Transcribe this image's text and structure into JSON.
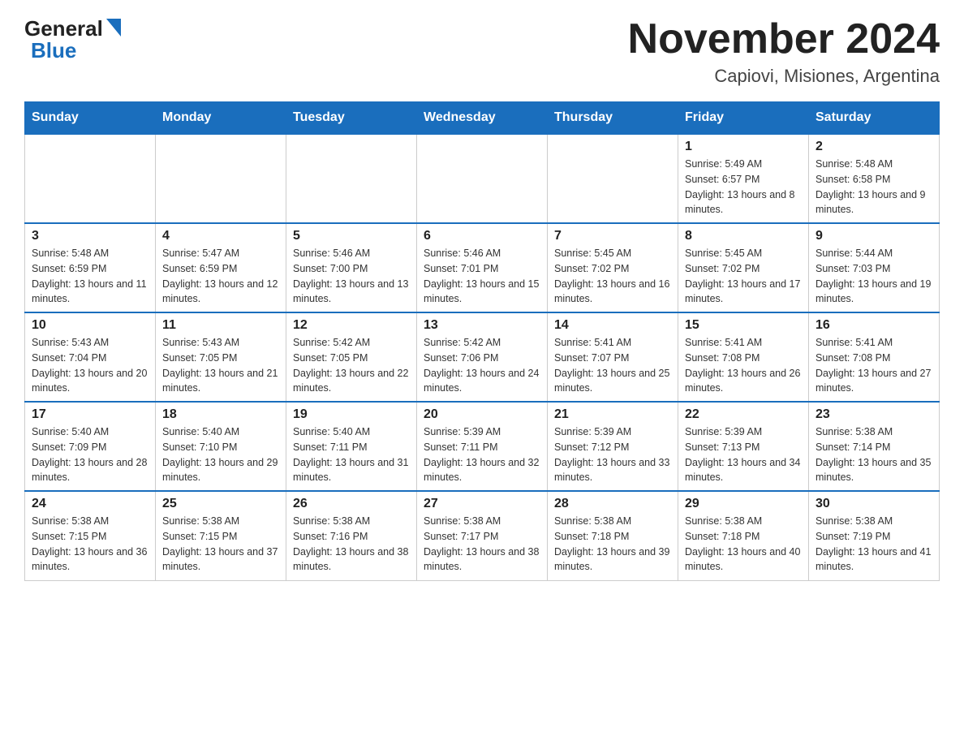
{
  "header": {
    "logo_general": "General",
    "logo_blue": "Blue",
    "title": "November 2024",
    "subtitle": "Capiovi, Misiones, Argentina"
  },
  "weekdays": [
    "Sunday",
    "Monday",
    "Tuesday",
    "Wednesday",
    "Thursday",
    "Friday",
    "Saturday"
  ],
  "weeks": [
    [
      {
        "day": "",
        "info": ""
      },
      {
        "day": "",
        "info": ""
      },
      {
        "day": "",
        "info": ""
      },
      {
        "day": "",
        "info": ""
      },
      {
        "day": "",
        "info": ""
      },
      {
        "day": "1",
        "info": "Sunrise: 5:49 AM\nSunset: 6:57 PM\nDaylight: 13 hours and 8 minutes."
      },
      {
        "day": "2",
        "info": "Sunrise: 5:48 AM\nSunset: 6:58 PM\nDaylight: 13 hours and 9 minutes."
      }
    ],
    [
      {
        "day": "3",
        "info": "Sunrise: 5:48 AM\nSunset: 6:59 PM\nDaylight: 13 hours and 11 minutes."
      },
      {
        "day": "4",
        "info": "Sunrise: 5:47 AM\nSunset: 6:59 PM\nDaylight: 13 hours and 12 minutes."
      },
      {
        "day": "5",
        "info": "Sunrise: 5:46 AM\nSunset: 7:00 PM\nDaylight: 13 hours and 13 minutes."
      },
      {
        "day": "6",
        "info": "Sunrise: 5:46 AM\nSunset: 7:01 PM\nDaylight: 13 hours and 15 minutes."
      },
      {
        "day": "7",
        "info": "Sunrise: 5:45 AM\nSunset: 7:02 PM\nDaylight: 13 hours and 16 minutes."
      },
      {
        "day": "8",
        "info": "Sunrise: 5:45 AM\nSunset: 7:02 PM\nDaylight: 13 hours and 17 minutes."
      },
      {
        "day": "9",
        "info": "Sunrise: 5:44 AM\nSunset: 7:03 PM\nDaylight: 13 hours and 19 minutes."
      }
    ],
    [
      {
        "day": "10",
        "info": "Sunrise: 5:43 AM\nSunset: 7:04 PM\nDaylight: 13 hours and 20 minutes."
      },
      {
        "day": "11",
        "info": "Sunrise: 5:43 AM\nSunset: 7:05 PM\nDaylight: 13 hours and 21 minutes."
      },
      {
        "day": "12",
        "info": "Sunrise: 5:42 AM\nSunset: 7:05 PM\nDaylight: 13 hours and 22 minutes."
      },
      {
        "day": "13",
        "info": "Sunrise: 5:42 AM\nSunset: 7:06 PM\nDaylight: 13 hours and 24 minutes."
      },
      {
        "day": "14",
        "info": "Sunrise: 5:41 AM\nSunset: 7:07 PM\nDaylight: 13 hours and 25 minutes."
      },
      {
        "day": "15",
        "info": "Sunrise: 5:41 AM\nSunset: 7:08 PM\nDaylight: 13 hours and 26 minutes."
      },
      {
        "day": "16",
        "info": "Sunrise: 5:41 AM\nSunset: 7:08 PM\nDaylight: 13 hours and 27 minutes."
      }
    ],
    [
      {
        "day": "17",
        "info": "Sunrise: 5:40 AM\nSunset: 7:09 PM\nDaylight: 13 hours and 28 minutes."
      },
      {
        "day": "18",
        "info": "Sunrise: 5:40 AM\nSunset: 7:10 PM\nDaylight: 13 hours and 29 minutes."
      },
      {
        "day": "19",
        "info": "Sunrise: 5:40 AM\nSunset: 7:11 PM\nDaylight: 13 hours and 31 minutes."
      },
      {
        "day": "20",
        "info": "Sunrise: 5:39 AM\nSunset: 7:11 PM\nDaylight: 13 hours and 32 minutes."
      },
      {
        "day": "21",
        "info": "Sunrise: 5:39 AM\nSunset: 7:12 PM\nDaylight: 13 hours and 33 minutes."
      },
      {
        "day": "22",
        "info": "Sunrise: 5:39 AM\nSunset: 7:13 PM\nDaylight: 13 hours and 34 minutes."
      },
      {
        "day": "23",
        "info": "Sunrise: 5:38 AM\nSunset: 7:14 PM\nDaylight: 13 hours and 35 minutes."
      }
    ],
    [
      {
        "day": "24",
        "info": "Sunrise: 5:38 AM\nSunset: 7:15 PM\nDaylight: 13 hours and 36 minutes."
      },
      {
        "day": "25",
        "info": "Sunrise: 5:38 AM\nSunset: 7:15 PM\nDaylight: 13 hours and 37 minutes."
      },
      {
        "day": "26",
        "info": "Sunrise: 5:38 AM\nSunset: 7:16 PM\nDaylight: 13 hours and 38 minutes."
      },
      {
        "day": "27",
        "info": "Sunrise: 5:38 AM\nSunset: 7:17 PM\nDaylight: 13 hours and 38 minutes."
      },
      {
        "day": "28",
        "info": "Sunrise: 5:38 AM\nSunset: 7:18 PM\nDaylight: 13 hours and 39 minutes."
      },
      {
        "day": "29",
        "info": "Sunrise: 5:38 AM\nSunset: 7:18 PM\nDaylight: 13 hours and 40 minutes."
      },
      {
        "day": "30",
        "info": "Sunrise: 5:38 AM\nSunset: 7:19 PM\nDaylight: 13 hours and 41 minutes."
      }
    ]
  ]
}
